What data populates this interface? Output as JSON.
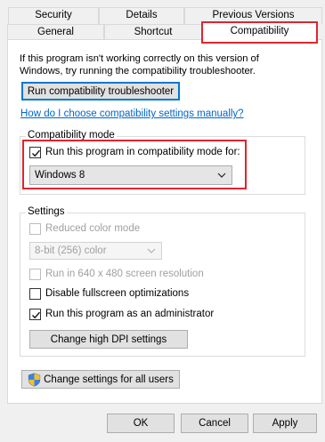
{
  "tabs": {
    "row1": [
      "Security",
      "Details",
      "Previous Versions"
    ],
    "row2": [
      "General",
      "Shortcut",
      "Compatibility"
    ],
    "selected": "Compatibility"
  },
  "intro_text": "If this program isn't working correctly on this version of Windows, try running the compatibility troubleshooter.",
  "troubleshooter_button": "Run compatibility troubleshooter",
  "manual_link": "How do I choose compatibility settings manually?",
  "compat_mode": {
    "label": "Compatibility mode",
    "checkbox_label": "Run this program in compatibility mode for:",
    "checked": true,
    "selected_os": "Windows 8"
  },
  "settings": {
    "label": "Settings",
    "reduced_color": {
      "label": "Reduced color mode",
      "checked": false,
      "enabled": false
    },
    "color_select": "8-bit (256) color",
    "run_640": {
      "label": "Run in 640 x 480 screen resolution",
      "checked": false,
      "enabled": false
    },
    "disable_fullscreen": {
      "label": "Disable fullscreen optimizations",
      "checked": false,
      "enabled": true
    },
    "run_admin": {
      "label": "Run this program as an administrator",
      "checked": true,
      "enabled": true
    },
    "dpi_button": "Change high DPI settings"
  },
  "all_users_button": "Change settings for all users",
  "dialog_buttons": {
    "ok": "OK",
    "cancel": "Cancel",
    "apply": "Apply"
  },
  "colors": {
    "highlight": "#e0252d",
    "link": "#0066cc",
    "focus": "#0078d7"
  },
  "icons": [
    "checkmark-icon",
    "chevron-down-icon",
    "uac-shield-icon"
  ]
}
